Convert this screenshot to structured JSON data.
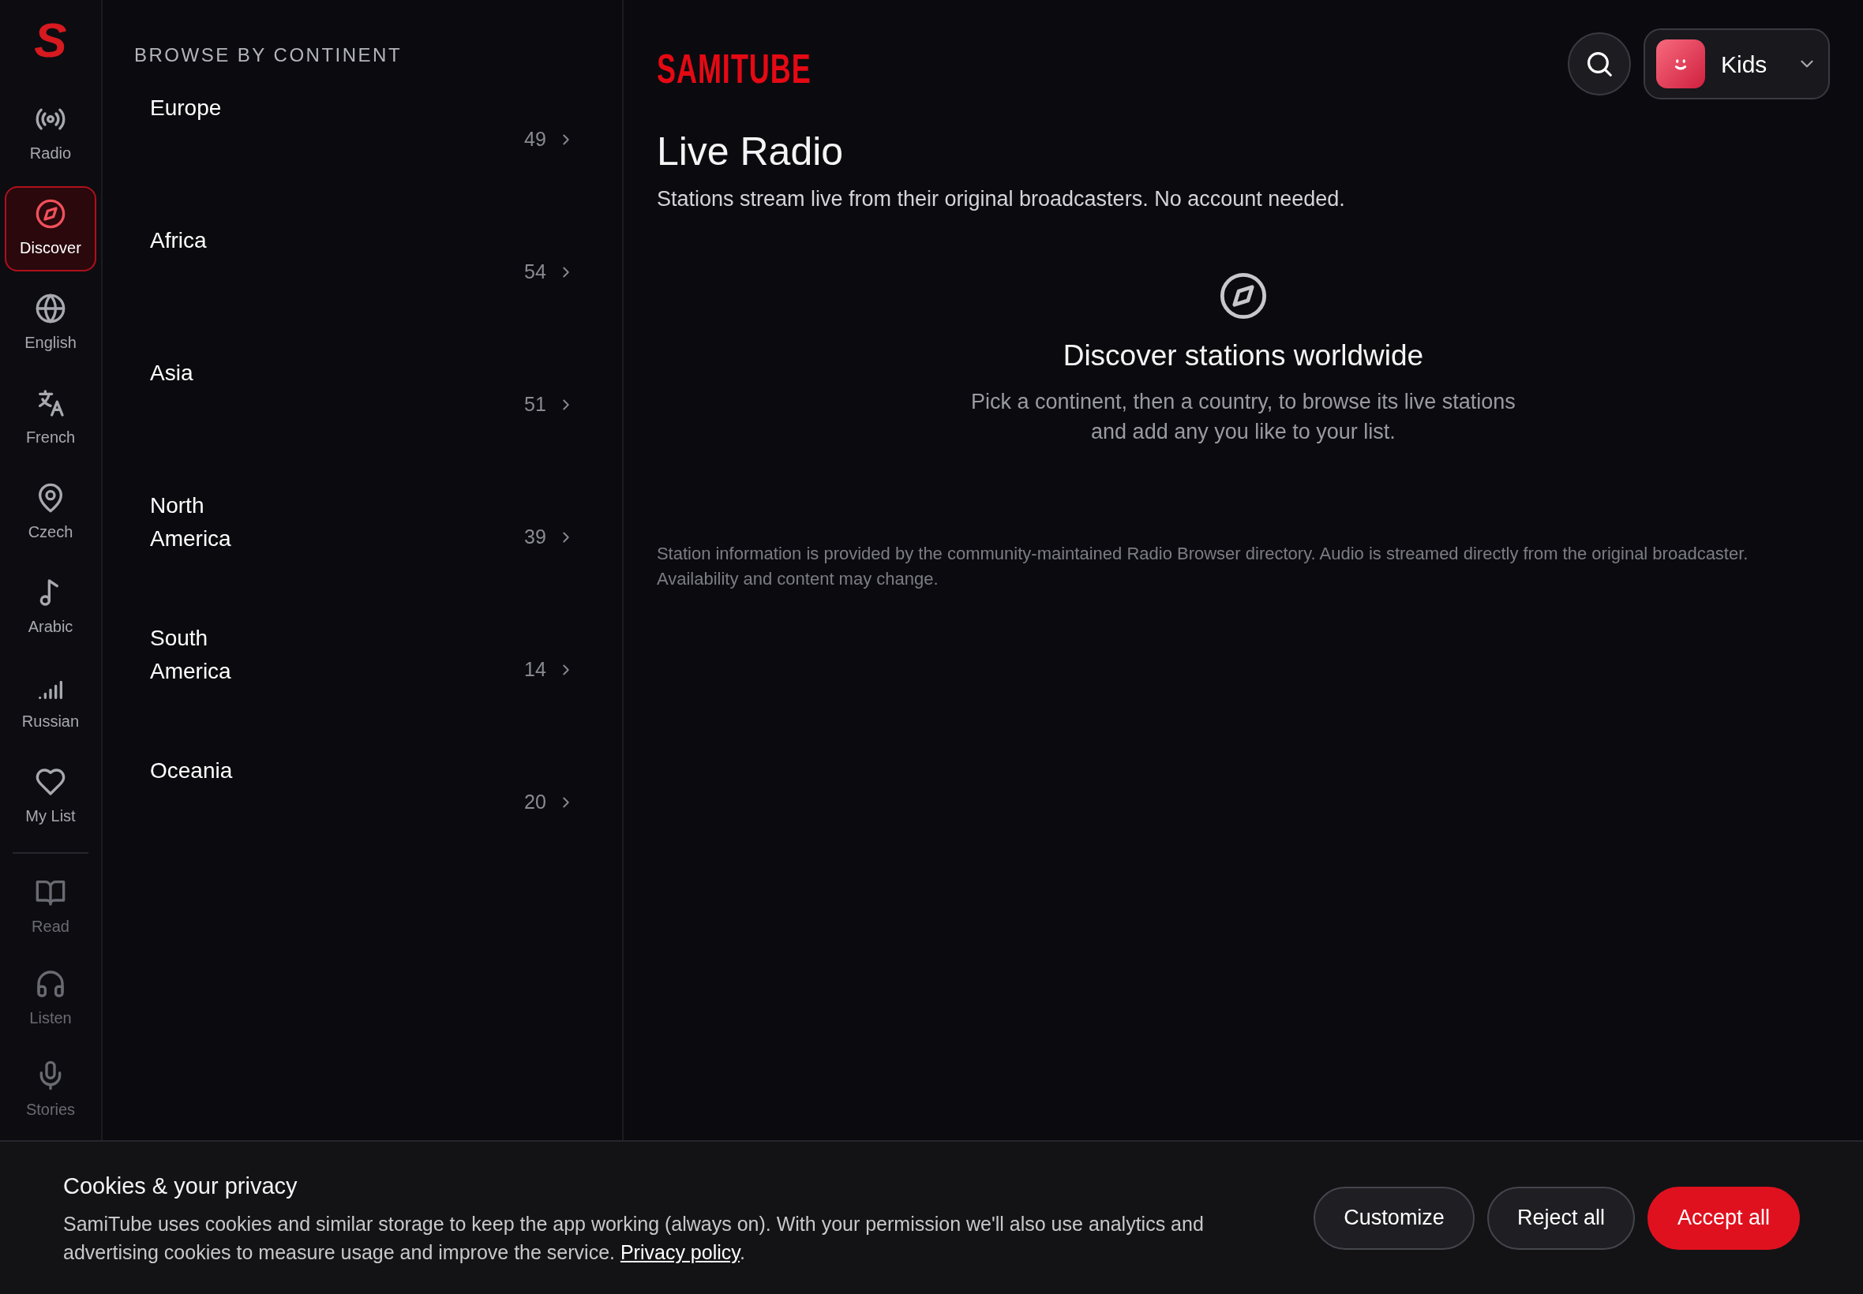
{
  "app": {
    "logo_mark": "S",
    "brand": "SAMITUBE"
  },
  "sidebar": {
    "items": [
      {
        "label": "Radio",
        "selected": false
      },
      {
        "label": "Discover",
        "selected": true
      },
      {
        "label": "English",
        "selected": false
      },
      {
        "label": "French",
        "selected": false
      },
      {
        "label": "Czech",
        "selected": false
      },
      {
        "label": "Arabic",
        "selected": false
      },
      {
        "label": "Russian",
        "selected": false
      },
      {
        "label": "My List",
        "selected": false
      }
    ],
    "secondary_items": [
      {
        "label": "Read"
      },
      {
        "label": "Listen"
      },
      {
        "label": "Stories"
      }
    ]
  },
  "continents": {
    "heading": "BROWSE BY CONTINENT",
    "items": [
      {
        "name": "Europe",
        "count": "49"
      },
      {
        "name": "Africa",
        "count": "54"
      },
      {
        "name": "Asia",
        "count": "51"
      },
      {
        "name": "North America",
        "count": "39"
      },
      {
        "name": "South America",
        "count": "14"
      },
      {
        "name": "Oceania",
        "count": "20"
      }
    ]
  },
  "header": {
    "profile": "Kids"
  },
  "main": {
    "title": "Live Radio",
    "subtitle": "Stations stream live from their original broadcasters. No account needed.",
    "empty_title": "Discover stations worldwide",
    "empty_text": "Pick a continent, then a country, to browse its live stations and add any you like to your list.",
    "disclaimer": "Station information is provided by the community-maintained Radio Browser directory. Audio is streamed directly from the original broadcaster. Availability and content may change."
  },
  "cookie_banner": {
    "title": "Cookies & your privacy",
    "text": "SamiTube uses cookies and similar storage to keep the app working (always on). With your permission we'll also use analytics and advertising cookies to measure usage and improve the service. ",
    "link": "Privacy policy",
    "suffix": ".",
    "buttons": [
      {
        "label": "Customize",
        "kind": "secondary"
      },
      {
        "label": "Reject all",
        "kind": "secondary"
      },
      {
        "label": "Accept all",
        "kind": "primary"
      }
    ]
  }
}
